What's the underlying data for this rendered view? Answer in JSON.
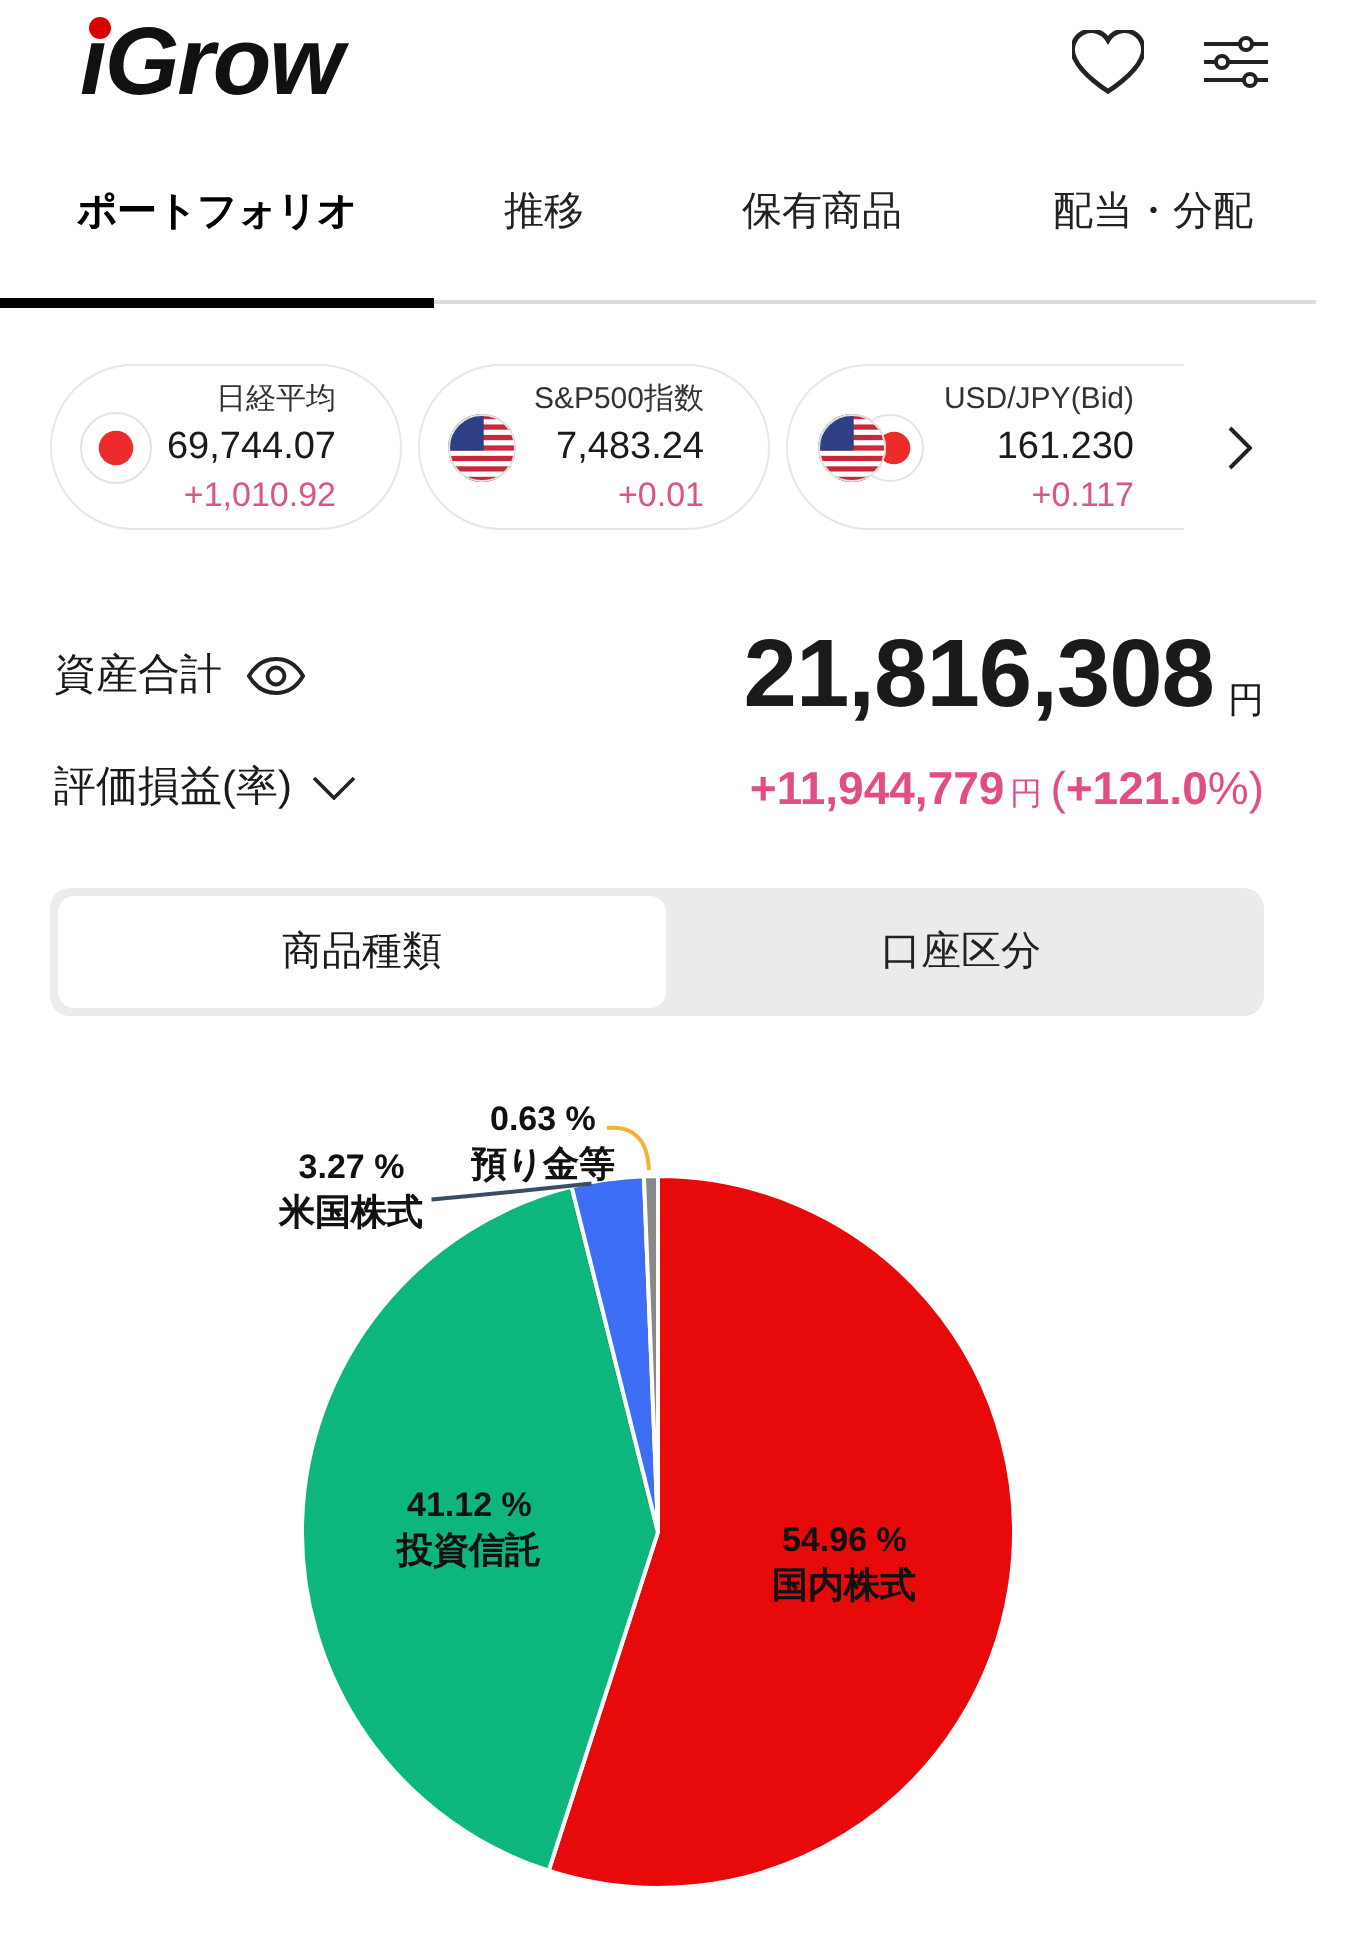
{
  "header": {
    "logo": "iGrow"
  },
  "tabs": [
    {
      "label": "ポートフォリオ",
      "selected": true
    },
    {
      "label": "推移",
      "selected": false
    },
    {
      "label": "保有商品",
      "selected": false
    },
    {
      "label": "配当・分配",
      "selected": false
    }
  ],
  "tickers": [
    {
      "kind": "jp",
      "name": "日経平均",
      "value": "69,744.07",
      "change": "+1,010.92"
    },
    {
      "kind": "us",
      "name": "S&P500指数",
      "value": "7,483.24",
      "change": "+0.01"
    },
    {
      "kind": "us-jp",
      "name": "USD/JPY(Bid)",
      "value": "161.230",
      "change": "+0.117"
    }
  ],
  "total": {
    "label": "資産合計",
    "amount": "21,816,308",
    "unit": "円"
  },
  "gain": {
    "label": "評価損益(率)",
    "amount": "+11,944,779",
    "unit": "円",
    "rate": "(**+121.0**%)"
  },
  "segments": [
    {
      "label": "商品種類",
      "selected": true
    },
    {
      "label": "口座区分",
      "selected": false
    }
  ],
  "allocation": {
    "chart_data": {
      "type": "pie",
      "categories": [
        "国内株式",
        "投資信託",
        "米国株式",
        "預り金等"
      ],
      "values": [
        54.96,
        41.12,
        3.27,
        0.63
      ],
      "value_labels": [
        "54.96 %",
        "41.12 %",
        "3.27 %",
        "0.63 %"
      ],
      "colors": [
        "#e80a0a",
        "#0db67c",
        "#3d6ef5",
        "#888888"
      ]
    }
  }
}
